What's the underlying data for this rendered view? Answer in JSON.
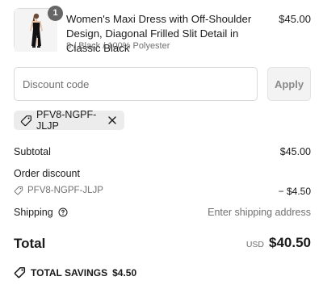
{
  "line_item": {
    "quantity": "1",
    "title": "Women's Maxi Dress with Off-Shoulder Design, Diagonal Frilled Slit Detail in Classic Black",
    "variant": "8 / Black / 100% Polyester",
    "price": "$45.00"
  },
  "discount": {
    "placeholder": "Discount code",
    "apply_label": "Apply",
    "applied_code": "PFV8-NGPF-JLJP"
  },
  "summary": {
    "subtotal_label": "Subtotal",
    "subtotal_value": "$45.00",
    "order_discount_label": "Order discount",
    "discount_code": "PFV8-NGPF-JLJP",
    "discount_value": "− $4.50",
    "shipping_label": "Shipping",
    "shipping_value": "Enter shipping address",
    "total_label": "Total",
    "currency": "USD",
    "total_value": "$40.50",
    "savings_label": "TOTAL SAVINGS",
    "savings_value": "$4.50"
  },
  "colors": {
    "text": "#1a1a1a",
    "muted": "#707070",
    "badge": "#666666",
    "chip_bg": "#ececec"
  }
}
